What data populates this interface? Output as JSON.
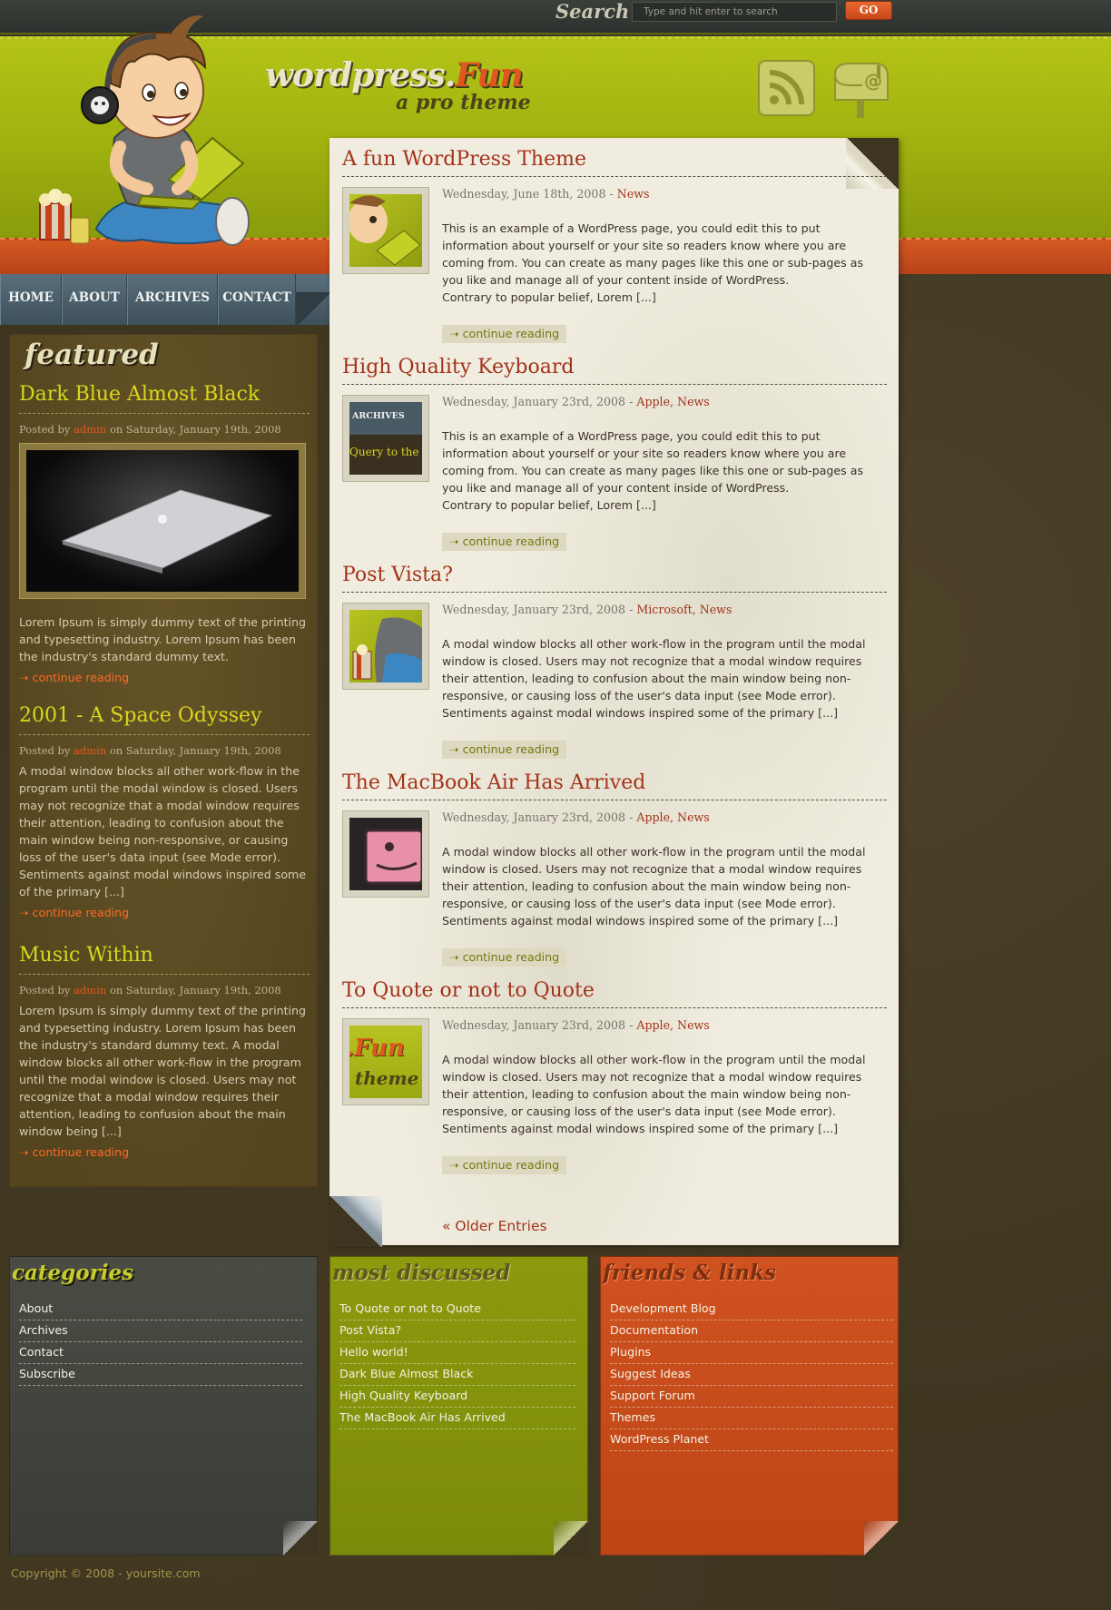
{
  "header": {
    "search_label": "Search",
    "search_placeholder": "Type and hit enter to search",
    "go_label": "GO",
    "logo_main": "wordpress.",
    "logo_fun": "Fun",
    "logo_sub": "a pro theme"
  },
  "nav": {
    "items": [
      "HOME",
      "ABOUT",
      "ARCHIVES",
      "CONTACT"
    ]
  },
  "featured": {
    "heading": "featured",
    "posts": [
      {
        "title": "Dark Blue Almost Black",
        "meta_prefix": "Posted by",
        "author": "admin",
        "meta_date": "on Saturday, January 19th, 2008",
        "text": "Lorem Ipsum is simply dummy text of the printing and typesetting industry. Lorem Ipsum has been the industry's standard dummy text.",
        "more": "continue reading"
      },
      {
        "title": "2001 - A Space Odyssey",
        "meta_prefix": "Posted by",
        "author": "admin",
        "meta_date": "on Saturday, January 19th, 2008",
        "text": "A modal window blocks all other work-flow in the program until the modal window is closed. Users may not recognize that a modal window requires their attention, leading to confusion about the main window being non-responsive, or causing loss of the user's data input (see Mode error). Sentiments against modal windows inspired some of the primary [...]",
        "more": "continue reading"
      },
      {
        "title": "Music Within",
        "meta_prefix": "Posted by",
        "author": "admin",
        "meta_date": "on Saturday, January 19th, 2008",
        "text": "Lorem Ipsum is simply dummy text of the printing and typesetting industry. Lorem Ipsum has been the industry's standard dummy text. A modal window blocks all other work-flow in the program until the modal window is closed. Users may not recognize that a modal window requires their attention, leading to confusion about the main window being [...]",
        "more": "continue reading"
      }
    ]
  },
  "posts": [
    {
      "title": "A fun WordPress Theme",
      "date": "Wednesday, June 18th, 2008",
      "sep": " - ",
      "categories": "News",
      "body": "This is an example of a WordPress page, you could edit this to put information about yourself or your site so readers know where you are coming from. You can create as many pages like this one or sub-pages as you like and manage all of your content inside of WordPress.",
      "body2": "Contrary to popular belief, Lorem [...]",
      "more": "continue reading"
    },
    {
      "title": "High Quality Keyboard",
      "date": "Wednesday, January 23rd, 2008",
      "sep": " - ",
      "categories": "Apple, News",
      "body": "This is an example of a WordPress page, you could edit this to put information about yourself or your site so readers know where you are coming from. You can create as many pages like this one or sub-pages as you like and manage all of your content inside of WordPress.",
      "body2": "Contrary to popular belief, Lorem [...]",
      "thumb_text1": "ARCHIVES",
      "thumb_text2": "Query to the N",
      "more": "continue reading"
    },
    {
      "title": "Post Vista?",
      "date": "Wednesday, January 23rd, 2008",
      "sep": " - ",
      "categories": "Microsoft, News",
      "body": "A modal window blocks all other work-flow in the program until the modal window is closed. Users may not recognize that a modal window requires their attention, leading to confusion about the main window being non-responsive, or causing loss of the user's data input (see Mode error). Sentiments against modal windows inspired some of the primary [...]",
      "more": "continue reading"
    },
    {
      "title": "The MacBook Air Has Arrived",
      "date": "Wednesday, January 23rd, 2008",
      "sep": " - ",
      "categories": "Apple, News",
      "body": "A modal window blocks all other work-flow in the program until the modal window is closed. Users may not recognize that a modal window requires their attention, leading to confusion about the main window being non-responsive, or causing loss of the user's data input (see Mode error). Sentiments against modal windows inspired some of the primary [...]",
      "more": "continue reading"
    },
    {
      "title": "To Quote or not to Quote",
      "date": "Wednesday, January 23rd, 2008",
      "sep": " - ",
      "categories": "Apple, News",
      "body": "A modal window blocks all other work-flow in the program until the modal window is closed. Users may not recognize that a modal window requires their attention, leading to confusion about the main window being non-responsive, or causing loss of the user's data input (see Mode error). Sentiments against modal windows inspired some of the primary [...]",
      "thumb_text1": ".Fun",
      "thumb_text2": "theme",
      "more": "continue reading"
    }
  ],
  "older_entries": "« Older Entries",
  "categories": {
    "heading": "categories",
    "items": [
      "About",
      "Archives",
      "Contact",
      "Subscribe"
    ]
  },
  "most_discussed": {
    "heading": "most discussed",
    "items": [
      "To Quote or not to Quote",
      "Post Vista?",
      "Hello world!",
      "Dark Blue Almost Black",
      "High Quality Keyboard",
      "The MacBook Air Has Arrived"
    ]
  },
  "friends_links": {
    "heading": "friends & links",
    "items": [
      "Development Blog",
      "Documentation",
      "Plugins",
      "Suggest Ideas",
      "Support Forum",
      "Themes",
      "WordPress Planet"
    ]
  },
  "footer": {
    "copyright": "Copyright © 2008 - yoursite.com"
  },
  "colors": {
    "accent_green": "#a3b413",
    "accent_orange": "#d55a22",
    "post_title": "#a3321a",
    "featured_title": "#d6d81c"
  }
}
